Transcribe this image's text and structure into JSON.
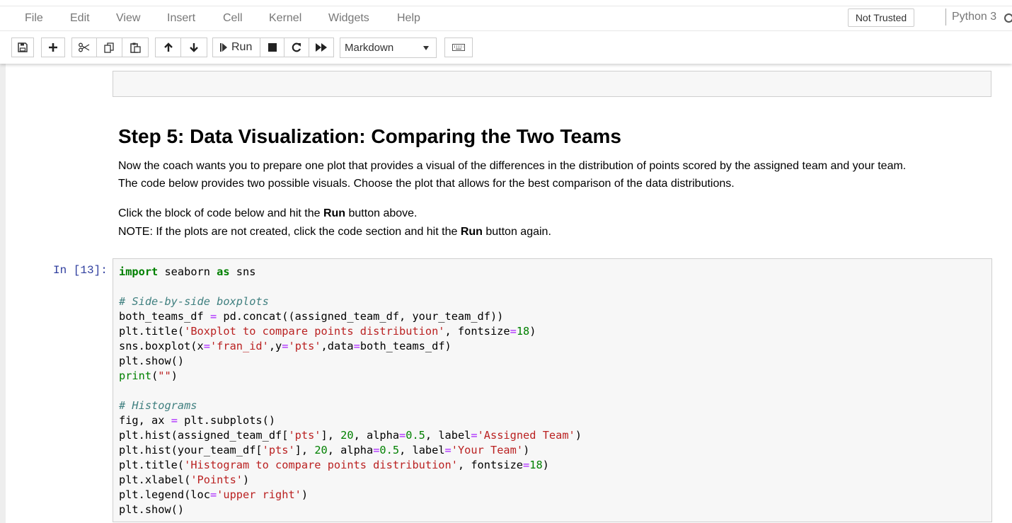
{
  "menu": [
    "File",
    "Edit",
    "View",
    "Insert",
    "Cell",
    "Kernel",
    "Widgets",
    "Help"
  ],
  "trust_status": "Not Trusted",
  "kernel": "Python 3",
  "toolbar": {
    "run_label": "Run",
    "cell_type": "Markdown",
    "icons": [
      "save-icon",
      "plus-icon",
      "cut-icon",
      "copy-icon",
      "paste-icon",
      "arrow-up-icon",
      "arrow-down-icon",
      "step-forward-icon",
      "stop-icon",
      "restart-icon",
      "fast-forward-icon",
      "keyboard-icon"
    ]
  },
  "markdown": {
    "heading": "Step 5: Data Visualization: Comparing the Two Teams",
    "para1_line1": "Now the coach wants you to prepare one plot that provides a visual of the differences in the distribution of points scored by the assigned team and your team.",
    "para1_line2": "The code below provides two possible visuals. Choose the plot that allows for the best comparison of the data distributions.",
    "para2_line1_pre": "Click the block of code below and hit the ",
    "para2_line1_bold": "Run",
    "para2_line1_post": " button above.",
    "para2_line2_pre": "NOTE: If the plots are not created, click the code section and hit the ",
    "para2_line2_bold": "Run",
    "para2_line2_post": " button again."
  },
  "code_cell": {
    "prompt": "In [13]:",
    "lines": [
      "import seaborn as sns",
      "",
      "# Side-by-side boxplots",
      "both_teams_df = pd.concat((assigned_team_df, your_team_df))",
      "plt.title('Boxplot to compare points distribution', fontsize=18)",
      "sns.boxplot(x='fran_id',y='pts',data=both_teams_df)",
      "plt.show()",
      "print(\"\")",
      "",
      "# Histograms",
      "fig, ax = plt.subplots()",
      "plt.hist(assigned_team_df['pts'], 20, alpha=0.5, label='Assigned Team')",
      "plt.hist(your_team_df['pts'], 20, alpha=0.5, label='Your Team')",
      "plt.title('Histogram to compare points distribution', fontsize=18)",
      "plt.xlabel('Points')",
      "plt.legend(loc='upper right')",
      "plt.show()"
    ]
  }
}
